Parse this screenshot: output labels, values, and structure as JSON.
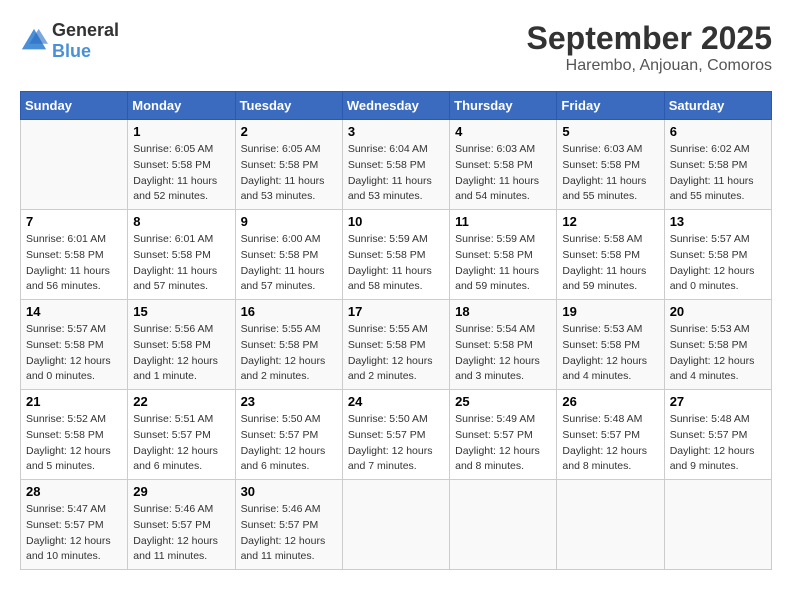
{
  "logo": {
    "general": "General",
    "blue": "Blue"
  },
  "title": "September 2025",
  "subtitle": "Harembo, Anjouan, Comoros",
  "days_of_week": [
    "Sunday",
    "Monday",
    "Tuesday",
    "Wednesday",
    "Thursday",
    "Friday",
    "Saturday"
  ],
  "weeks": [
    [
      {
        "day": "",
        "info": ""
      },
      {
        "day": "1",
        "info": "Sunrise: 6:05 AM\nSunset: 5:58 PM\nDaylight: 11 hours\nand 52 minutes."
      },
      {
        "day": "2",
        "info": "Sunrise: 6:05 AM\nSunset: 5:58 PM\nDaylight: 11 hours\nand 53 minutes."
      },
      {
        "day": "3",
        "info": "Sunrise: 6:04 AM\nSunset: 5:58 PM\nDaylight: 11 hours\nand 53 minutes."
      },
      {
        "day": "4",
        "info": "Sunrise: 6:03 AM\nSunset: 5:58 PM\nDaylight: 11 hours\nand 54 minutes."
      },
      {
        "day": "5",
        "info": "Sunrise: 6:03 AM\nSunset: 5:58 PM\nDaylight: 11 hours\nand 55 minutes."
      },
      {
        "day": "6",
        "info": "Sunrise: 6:02 AM\nSunset: 5:58 PM\nDaylight: 11 hours\nand 55 minutes."
      }
    ],
    [
      {
        "day": "7",
        "info": "Sunrise: 6:01 AM\nSunset: 5:58 PM\nDaylight: 11 hours\nand 56 minutes."
      },
      {
        "day": "8",
        "info": "Sunrise: 6:01 AM\nSunset: 5:58 PM\nDaylight: 11 hours\nand 57 minutes."
      },
      {
        "day": "9",
        "info": "Sunrise: 6:00 AM\nSunset: 5:58 PM\nDaylight: 11 hours\nand 57 minutes."
      },
      {
        "day": "10",
        "info": "Sunrise: 5:59 AM\nSunset: 5:58 PM\nDaylight: 11 hours\nand 58 minutes."
      },
      {
        "day": "11",
        "info": "Sunrise: 5:59 AM\nSunset: 5:58 PM\nDaylight: 11 hours\nand 59 minutes."
      },
      {
        "day": "12",
        "info": "Sunrise: 5:58 AM\nSunset: 5:58 PM\nDaylight: 11 hours\nand 59 minutes."
      },
      {
        "day": "13",
        "info": "Sunrise: 5:57 AM\nSunset: 5:58 PM\nDaylight: 12 hours\nand 0 minutes."
      }
    ],
    [
      {
        "day": "14",
        "info": "Sunrise: 5:57 AM\nSunset: 5:58 PM\nDaylight: 12 hours\nand 0 minutes."
      },
      {
        "day": "15",
        "info": "Sunrise: 5:56 AM\nSunset: 5:58 PM\nDaylight: 12 hours\nand 1 minute."
      },
      {
        "day": "16",
        "info": "Sunrise: 5:55 AM\nSunset: 5:58 PM\nDaylight: 12 hours\nand 2 minutes."
      },
      {
        "day": "17",
        "info": "Sunrise: 5:55 AM\nSunset: 5:58 PM\nDaylight: 12 hours\nand 2 minutes."
      },
      {
        "day": "18",
        "info": "Sunrise: 5:54 AM\nSunset: 5:58 PM\nDaylight: 12 hours\nand 3 minutes."
      },
      {
        "day": "19",
        "info": "Sunrise: 5:53 AM\nSunset: 5:58 PM\nDaylight: 12 hours\nand 4 minutes."
      },
      {
        "day": "20",
        "info": "Sunrise: 5:53 AM\nSunset: 5:58 PM\nDaylight: 12 hours\nand 4 minutes."
      }
    ],
    [
      {
        "day": "21",
        "info": "Sunrise: 5:52 AM\nSunset: 5:58 PM\nDaylight: 12 hours\nand 5 minutes."
      },
      {
        "day": "22",
        "info": "Sunrise: 5:51 AM\nSunset: 5:57 PM\nDaylight: 12 hours\nand 6 minutes."
      },
      {
        "day": "23",
        "info": "Sunrise: 5:50 AM\nSunset: 5:57 PM\nDaylight: 12 hours\nand 6 minutes."
      },
      {
        "day": "24",
        "info": "Sunrise: 5:50 AM\nSunset: 5:57 PM\nDaylight: 12 hours\nand 7 minutes."
      },
      {
        "day": "25",
        "info": "Sunrise: 5:49 AM\nSunset: 5:57 PM\nDaylight: 12 hours\nand 8 minutes."
      },
      {
        "day": "26",
        "info": "Sunrise: 5:48 AM\nSunset: 5:57 PM\nDaylight: 12 hours\nand 8 minutes."
      },
      {
        "day": "27",
        "info": "Sunrise: 5:48 AM\nSunset: 5:57 PM\nDaylight: 12 hours\nand 9 minutes."
      }
    ],
    [
      {
        "day": "28",
        "info": "Sunrise: 5:47 AM\nSunset: 5:57 PM\nDaylight: 12 hours\nand 10 minutes."
      },
      {
        "day": "29",
        "info": "Sunrise: 5:46 AM\nSunset: 5:57 PM\nDaylight: 12 hours\nand 11 minutes."
      },
      {
        "day": "30",
        "info": "Sunrise: 5:46 AM\nSunset: 5:57 PM\nDaylight: 12 hours\nand 11 minutes."
      },
      {
        "day": "",
        "info": ""
      },
      {
        "day": "",
        "info": ""
      },
      {
        "day": "",
        "info": ""
      },
      {
        "day": "",
        "info": ""
      }
    ]
  ]
}
